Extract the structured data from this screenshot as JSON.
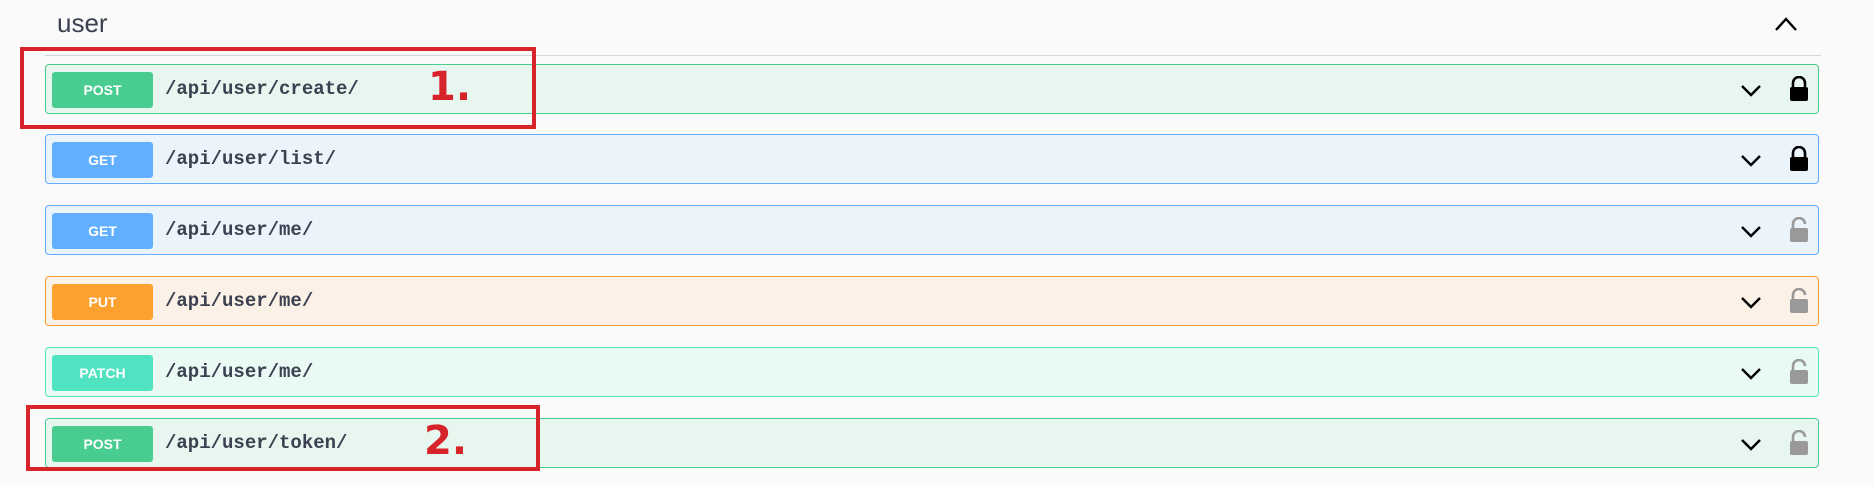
{
  "section": {
    "title": "user"
  },
  "colors": {
    "post": "#49cc90",
    "get": "#61affe",
    "put": "#fca130",
    "patch": "#50e3c2",
    "annotation": "#d7232a"
  },
  "operations": [
    {
      "method": "POST",
      "path": "/api/user/create/",
      "locked": true
    },
    {
      "method": "GET",
      "path": "/api/user/list/",
      "locked": true
    },
    {
      "method": "GET",
      "path": "/api/user/me/",
      "locked": false
    },
    {
      "method": "PUT",
      "path": "/api/user/me/",
      "locked": false
    },
    {
      "method": "PATCH",
      "path": "/api/user/me/",
      "locked": false
    },
    {
      "method": "POST",
      "path": "/api/user/token/",
      "locked": false
    }
  ],
  "annotations": [
    {
      "label": "1."
    },
    {
      "label": "2."
    }
  ]
}
